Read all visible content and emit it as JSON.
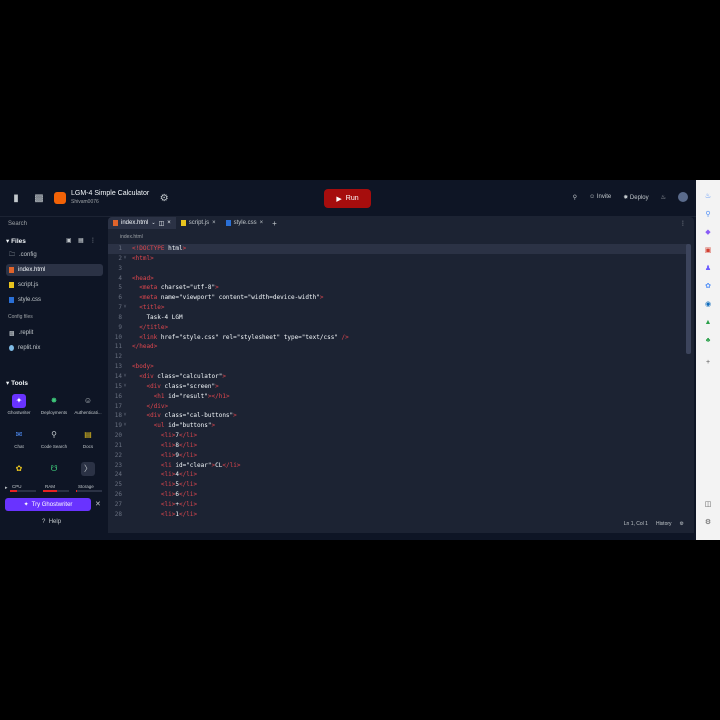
{
  "repl": {
    "name": "LGM-4 Simple Calculator",
    "owner": "Shivam0076"
  },
  "topbar": {
    "run_label": "Run",
    "invite_label": "Invite",
    "deploy_label": "Deploy"
  },
  "sidebar": {
    "search_label": "Search",
    "files_heading": "Files",
    "files": [
      {
        "name": ".config"
      },
      {
        "name": "index.html"
      },
      {
        "name": "script.js"
      },
      {
        "name": "style.css"
      }
    ],
    "config_heading": "Config files",
    "config_files": [
      {
        "name": ".replit"
      },
      {
        "name": "replit.nix"
      }
    ],
    "tools_heading": "Tools",
    "tools": [
      {
        "label": "Ghostwriter"
      },
      {
        "label": "Deployments"
      },
      {
        "label": "Authenticati..."
      },
      {
        "label": "Chat"
      },
      {
        "label": "Code Search"
      },
      {
        "label": "Docs"
      }
    ],
    "meters": [
      {
        "label": "CPU",
        "level": 0.25
      },
      {
        "label": "RAM",
        "level": 0.55
      },
      {
        "label": "Storage",
        "level": 0.05
      }
    ],
    "ghostwriter_button": "Try Ghostwriter",
    "help_label": "Help"
  },
  "editor": {
    "tabs": [
      {
        "label": "index.html"
      },
      {
        "label": "script.js"
      },
      {
        "label": "style.css"
      }
    ],
    "breadcrumb": "index.html",
    "status_position": "Ln 1, Col 1",
    "status_history": "History"
  },
  "code_lines": [
    {
      "n": "1",
      "text": "<!DOCTYPE html>"
    },
    {
      "n": "2",
      "text": "<html>"
    },
    {
      "n": "3",
      "text": ""
    },
    {
      "n": "4",
      "text": "<head>"
    },
    {
      "n": "5",
      "text": "  <meta charset=\"utf-8\">"
    },
    {
      "n": "6",
      "text": "  <meta name=\"viewport\" content=\"width=device-width\">"
    },
    {
      "n": "7",
      "text": "  <title>"
    },
    {
      "n": "8",
      "text": "    Task-4 LGM"
    },
    {
      "n": "9",
      "text": "  </title>"
    },
    {
      "n": "10",
      "text": "  <link href=\"style.css\" rel=\"stylesheet\" type=\"text/css\" />"
    },
    {
      "n": "11",
      "text": "</head>"
    },
    {
      "n": "12",
      "text": ""
    },
    {
      "n": "13",
      "text": "<body>"
    },
    {
      "n": "14",
      "text": "  <div class=\"calculator\">"
    },
    {
      "n": "15",
      "text": "    <div class=\"screen\">"
    },
    {
      "n": "16",
      "text": "      <h1 id=\"result\"></h1>"
    },
    {
      "n": "17",
      "text": "    </div>"
    },
    {
      "n": "18",
      "text": "    <div class=\"cal-buttons\">"
    },
    {
      "n": "19",
      "text": "      <ul id=\"buttons\">"
    },
    {
      "n": "20",
      "text": "        <li>7</li>"
    },
    {
      "n": "21",
      "text": "        <li>8</li>"
    },
    {
      "n": "22",
      "text": "        <li>9</li>"
    },
    {
      "n": "23",
      "text": "        <li id=\"clear\">CL</li>"
    },
    {
      "n": "24",
      "text": "        <li>4</li>"
    },
    {
      "n": "25",
      "text": "        <li>5</li>"
    },
    {
      "n": "26",
      "text": "        <li>6</li>"
    },
    {
      "n": "27",
      "text": "        <li>+</li>"
    },
    {
      "n": "28",
      "text": "        <li>1</li>"
    }
  ],
  "colors": {
    "run": "#a60d0d",
    "ghostwriter": "#6933ff",
    "tag": "#e0474e",
    "bg": "#0e1525",
    "editor_bg": "#1c2333"
  }
}
